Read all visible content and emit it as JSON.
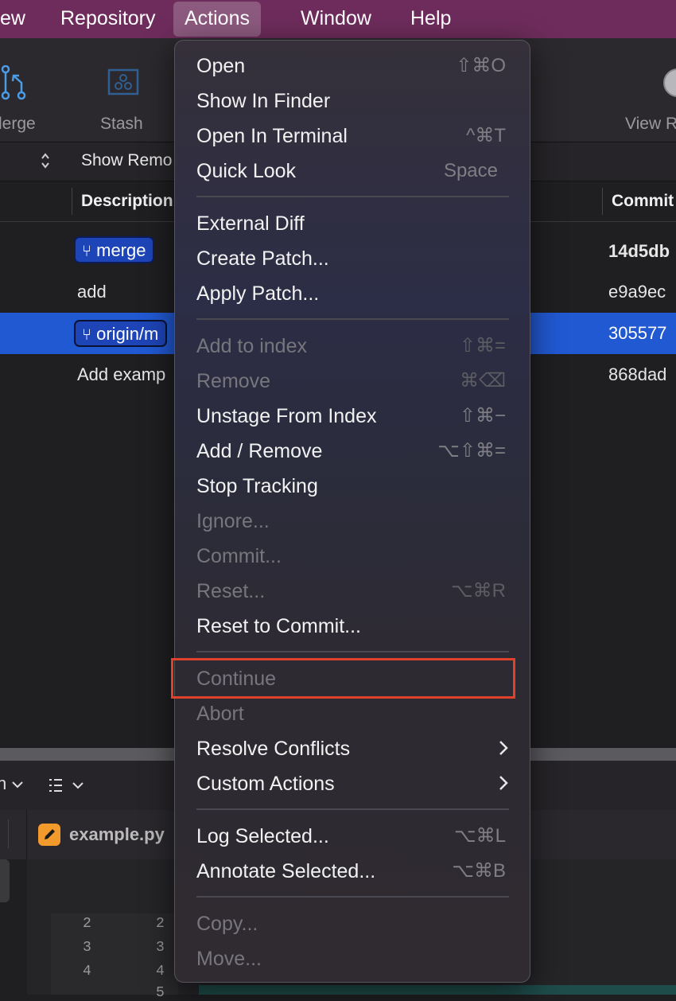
{
  "menubar": {
    "items": [
      "ew",
      "Repository",
      "Actions",
      "Window",
      "Help"
    ],
    "active": "Actions"
  },
  "toolbar": {
    "merge_label": "lerge",
    "stash_label": "Stash",
    "view_label": "View R"
  },
  "filterbar": {
    "show_remote": "Show Remo"
  },
  "table": {
    "headers": {
      "description": "Description",
      "commit": "Commit"
    },
    "rows": [
      {
        "badge": "merge",
        "description": "",
        "commit": "14d5db",
        "bold": true
      },
      {
        "badge": "",
        "description": "add",
        "commit": "e9a9ec"
      },
      {
        "badge": "origin/m",
        "description": "",
        "commit": "305577",
        "selected": true
      },
      {
        "badge": "",
        "description": "Add examp",
        "commit": "868dad"
      }
    ]
  },
  "bottom": {
    "branch_dropdown": "n",
    "file_tab": "example.py",
    "line_numbers_left": [
      "2",
      "3",
      "4"
    ],
    "line_numbers_right": [
      "2",
      "3",
      "4",
      "5"
    ]
  },
  "menu": {
    "items": [
      {
        "label": "Open",
        "shortcut": "⇧⌘O",
        "disabled": false
      },
      {
        "label": "Show In Finder",
        "shortcut": "",
        "disabled": false
      },
      {
        "label": "Open In Terminal",
        "shortcut": "^⌘T",
        "disabled": false
      },
      {
        "label": "Quick Look",
        "shortcut": "Space",
        "disabled": false
      },
      {
        "label": "External Diff",
        "shortcut": "",
        "disabled": false
      },
      {
        "label": "Create Patch...",
        "shortcut": "",
        "disabled": false
      },
      {
        "label": "Apply Patch...",
        "shortcut": "",
        "disabled": false
      },
      {
        "label": "Add to index",
        "shortcut": "⇧⌘=",
        "disabled": true
      },
      {
        "label": "Remove",
        "shortcut": "⌘⌫",
        "disabled": true
      },
      {
        "label": "Unstage From Index",
        "shortcut": "⇧⌘−",
        "disabled": false
      },
      {
        "label": "Add / Remove",
        "shortcut": "⌥⇧⌘=",
        "disabled": false
      },
      {
        "label": "Stop Tracking",
        "shortcut": "",
        "disabled": false
      },
      {
        "label": "Ignore...",
        "shortcut": "",
        "disabled": true
      },
      {
        "label": "Commit...",
        "shortcut": "",
        "disabled": true
      },
      {
        "label": "Reset...",
        "shortcut": "⌥⌘R",
        "disabled": true
      },
      {
        "label": "Reset to Commit...",
        "shortcut": "",
        "disabled": false
      },
      {
        "label": "Continue",
        "shortcut": "",
        "disabled": true,
        "highlighted": true
      },
      {
        "label": "Abort",
        "shortcut": "",
        "disabled": true
      },
      {
        "label": "Resolve Conflicts",
        "shortcut": "",
        "disabled": false,
        "submenu": true
      },
      {
        "label": "Custom Actions",
        "shortcut": "",
        "disabled": false,
        "submenu": true
      },
      {
        "label": "Log Selected...",
        "shortcut": "⌥⌘L",
        "disabled": false
      },
      {
        "label": "Annotate Selected...",
        "shortcut": "⌥⌘B",
        "disabled": false
      },
      {
        "label": "Copy...",
        "shortcut": "",
        "disabled": true
      },
      {
        "label": "Move...",
        "shortcut": "",
        "disabled": true
      }
    ]
  },
  "colors": {
    "menubar": "#6e2c5c",
    "selection": "#2159d3",
    "branch_badge": "#1e45b8",
    "highlight_box": "#e0412a",
    "file_icon": "#f39a2c"
  }
}
